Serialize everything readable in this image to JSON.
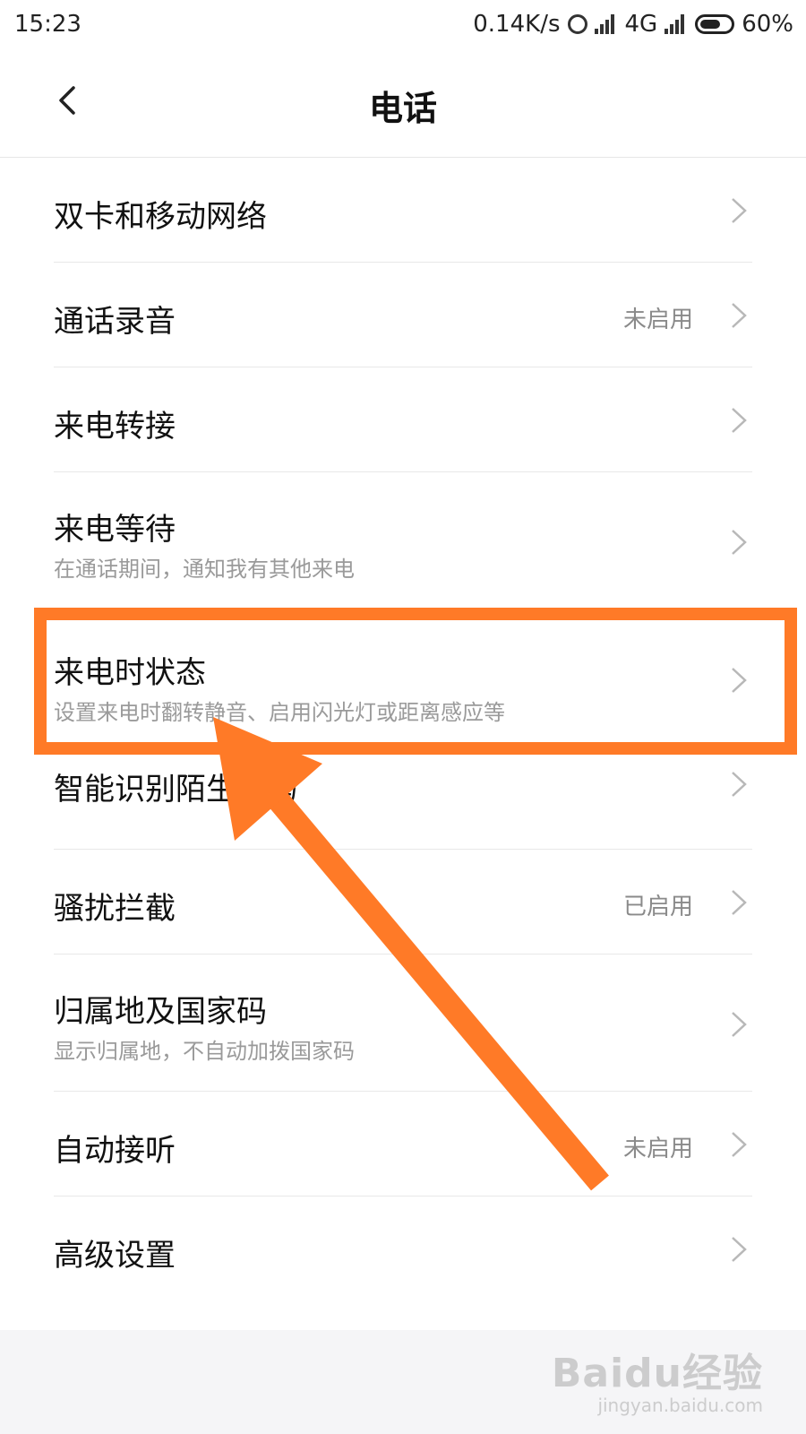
{
  "status_bar": {
    "time": "15:23",
    "network_speed": "0.14K/s",
    "network_type": "4G",
    "battery": "60%"
  },
  "header": {
    "title": "电话"
  },
  "items": [
    {
      "title": "双卡和移动网络",
      "subtitle": "",
      "value": ""
    },
    {
      "title": "通话录音",
      "subtitle": "",
      "value": "未启用"
    },
    {
      "title": "来电转接",
      "subtitle": "",
      "value": ""
    },
    {
      "title": "来电等待",
      "subtitle": "在通话期间，通知我有其他来电",
      "value": ""
    },
    {
      "title": "来电时状态",
      "subtitle": "设置来电时翻转静音、启用闪光灯或距离感应等",
      "value": ""
    },
    {
      "title": "智能识别陌生号码",
      "subtitle": "",
      "value": ""
    },
    {
      "title": "骚扰拦截",
      "subtitle": "",
      "value": "已启用"
    },
    {
      "title": "归属地及国家码",
      "subtitle": "显示归属地，不自动加拨国家码",
      "value": ""
    },
    {
      "title": "自动接听",
      "subtitle": "",
      "value": "未启用"
    },
    {
      "title": "高级设置",
      "subtitle": "",
      "value": ""
    }
  ],
  "watermark": {
    "logo": "Baidu经验",
    "url": "jingyan.baidu.com"
  },
  "colors": {
    "highlight": "#ff7a27",
    "subtitle": "#9a9a9a",
    "divider": "#e8e8e8"
  }
}
